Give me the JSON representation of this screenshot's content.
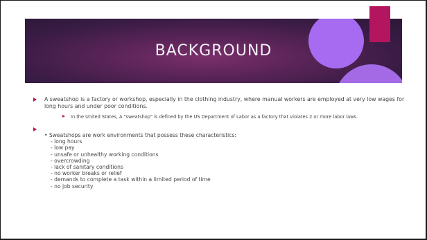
{
  "slide": {
    "title": "BACKGROUND",
    "accent_color": "#b3165e",
    "banner_color": "#4a1f4f",
    "circle_color": "#a66bf0",
    "bullet1": "A sweatshop is a factory or workshop, especially in the clothing industry, where manual workers are employed at very low wages for long hours and under poor conditions.",
    "sub_bullet": "In the United States, A \"sweatshop\" is defined by the US Department of Labor as a factory that violates 2 or more labor laws.",
    "list_intro": "• Sweatshops are work environments that possess these characteristics:",
    "characteristics": [
      "- long hours",
      "- low pay",
      "- unsafe or unhealthy working conditions",
      "- overcrowding",
      "- lack of sanitary conditions",
      "- no worker breaks or relief",
      "- demands to complete a task within a limited period of time",
      "- no job security"
    ]
  }
}
